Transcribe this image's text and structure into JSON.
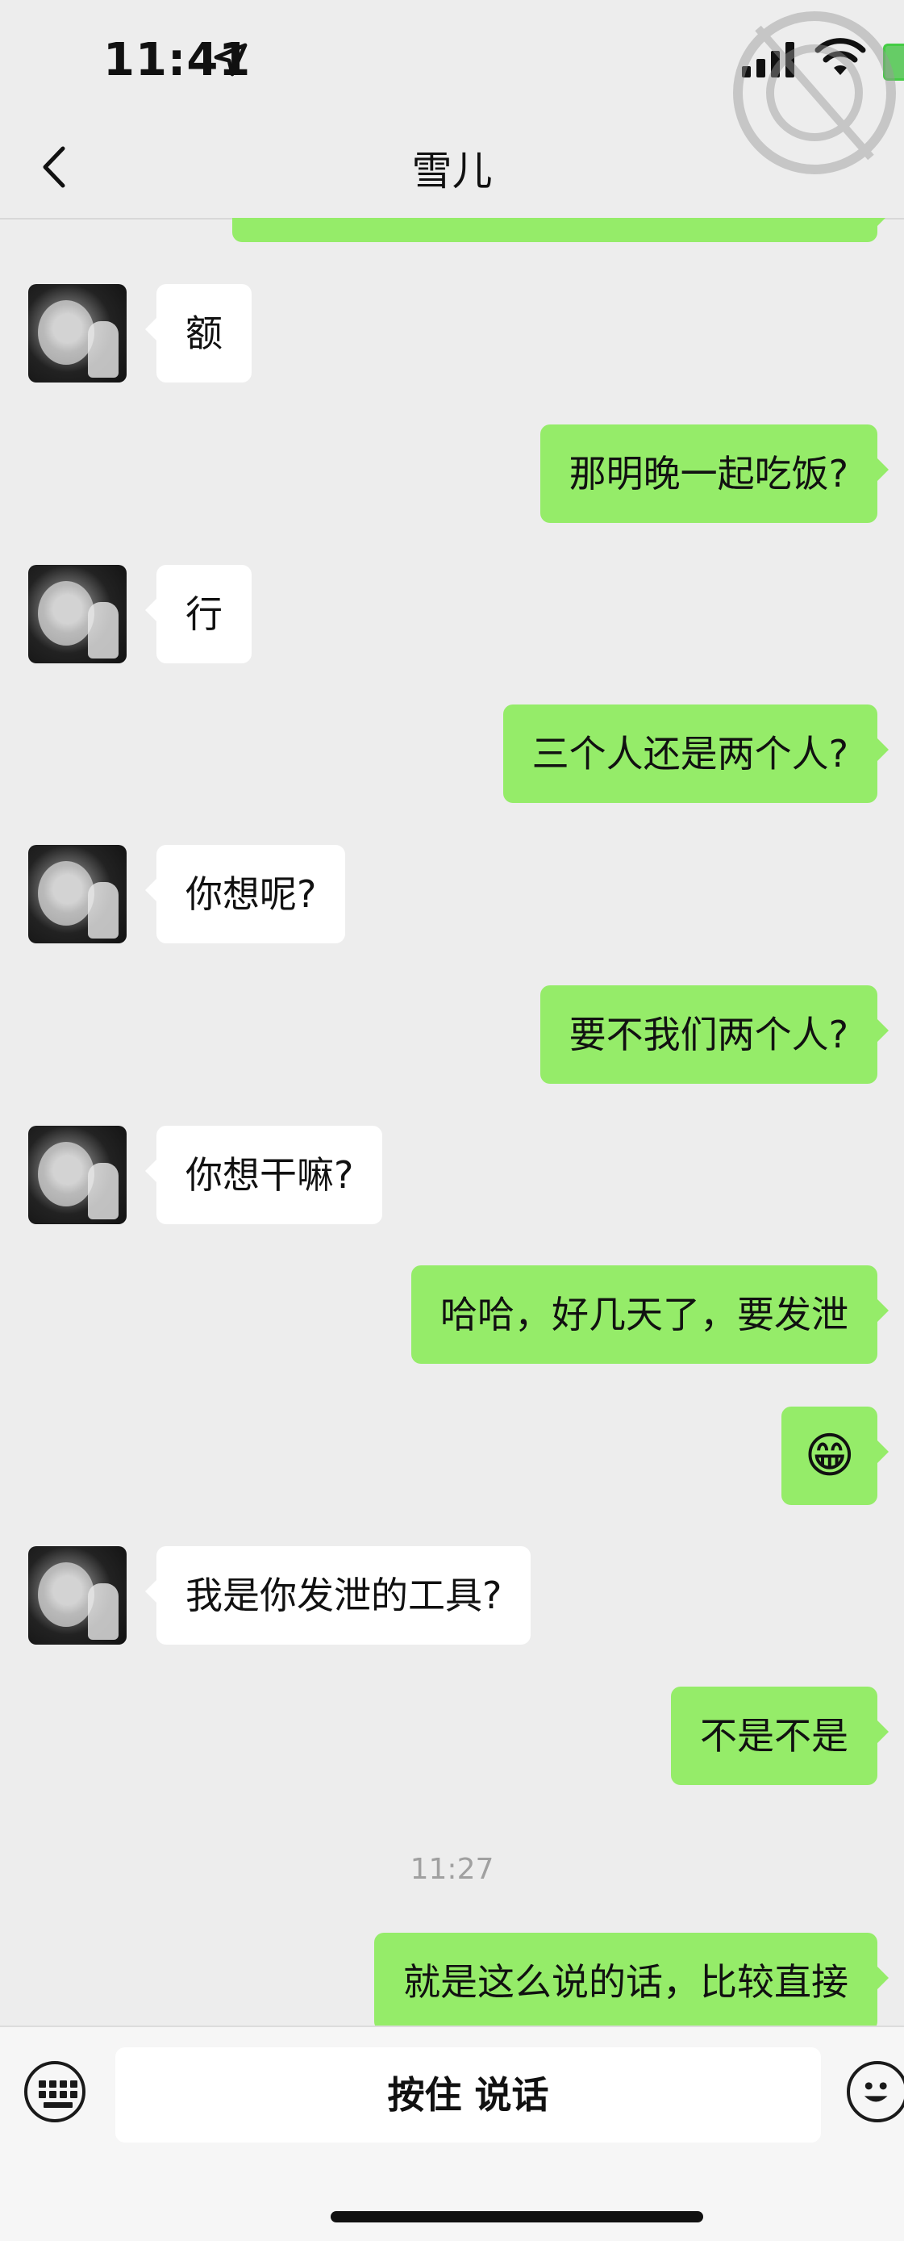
{
  "status_bar": {
    "time": "11:41"
  },
  "header": {
    "title": "雪儿"
  },
  "messages": [
    {
      "side": "in",
      "text": "额"
    },
    {
      "side": "out",
      "text": "那明晚一起吃饭?"
    },
    {
      "side": "in",
      "text": "行"
    },
    {
      "side": "out",
      "text": "三个人还是两个人?"
    },
    {
      "side": "in",
      "text": "你想呢?"
    },
    {
      "side": "out",
      "text": "要不我们两个人?"
    },
    {
      "side": "in",
      "text": "你想干嘛?"
    },
    {
      "side": "out",
      "text": "哈哈，好几天了，要发泄"
    },
    {
      "side": "out",
      "text": "😁"
    },
    {
      "side": "in",
      "text": "我是你发泄的工具?"
    },
    {
      "side": "out",
      "text": "不是不是"
    },
    {
      "side": "out",
      "text": "就是这么说的话，比较直接"
    }
  ],
  "timestamp": "11:27",
  "input_bar": {
    "hold_to_talk": "按住 说话"
  },
  "colors": {
    "outgoing": "#95ec69",
    "incoming": "#ffffff",
    "background": "#ededed"
  },
  "icons": [
    "location-arrow-icon",
    "signal-icon",
    "wifi-icon",
    "battery-icon",
    "back-chevron-icon",
    "keyboard-icon",
    "emoji-icon"
  ]
}
